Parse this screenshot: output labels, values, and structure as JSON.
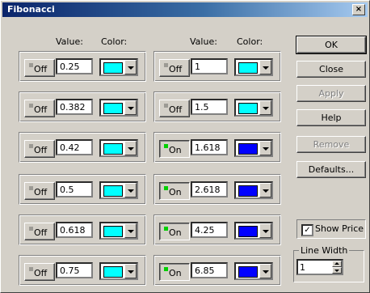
{
  "window": {
    "title": "Fibonacci",
    "close_label": "×"
  },
  "headers": {
    "value": "Value:",
    "color": "Color:"
  },
  "colors": {
    "cyan": "#00ffff",
    "blue": "#0000ff"
  },
  "levels_left": [
    {
      "state": "Off",
      "value": "0.25",
      "color": "cyan"
    },
    {
      "state": "Off",
      "value": "0.382",
      "color": "cyan"
    },
    {
      "state": "Off",
      "value": "0.42",
      "color": "cyan"
    },
    {
      "state": "Off",
      "value": "0.5",
      "color": "cyan"
    },
    {
      "state": "Off",
      "value": "0.618",
      "color": "cyan"
    },
    {
      "state": "Off",
      "value": "0.75",
      "color": "cyan"
    }
  ],
  "levels_right": [
    {
      "state": "Off",
      "value": "1",
      "color": "cyan"
    },
    {
      "state": "Off",
      "value": "1.5",
      "color": "cyan"
    },
    {
      "state": "On",
      "value": "1.618",
      "color": "blue"
    },
    {
      "state": "On",
      "value": "2.618",
      "color": "blue"
    },
    {
      "state": "On",
      "value": "4.25",
      "color": "blue"
    },
    {
      "state": "On",
      "value": "6.85",
      "color": "blue"
    }
  ],
  "buttons": {
    "ok": "OK",
    "close": "Close",
    "apply": "Apply",
    "help": "Help",
    "remove": "Remove",
    "defaults": "Defaults..."
  },
  "show_price": {
    "label": "Show Price",
    "checked": true,
    "mark": "✓"
  },
  "line_width": {
    "title": "Line Width",
    "value": "1"
  }
}
